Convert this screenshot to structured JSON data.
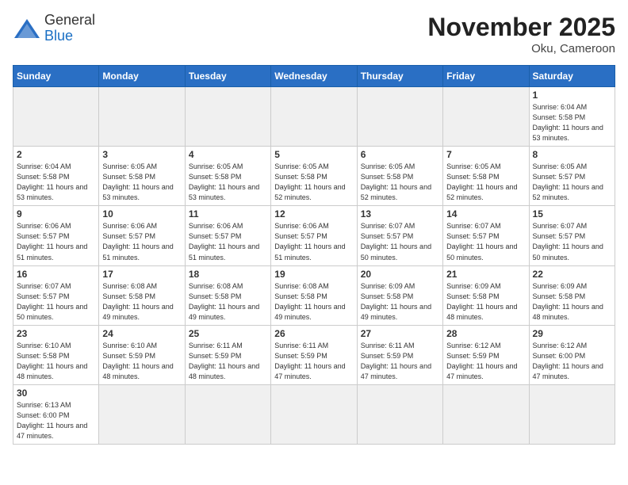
{
  "header": {
    "logo_general": "General",
    "logo_blue": "Blue",
    "month": "November 2025",
    "location": "Oku, Cameroon"
  },
  "days_of_week": [
    "Sunday",
    "Monday",
    "Tuesday",
    "Wednesday",
    "Thursday",
    "Friday",
    "Saturday"
  ],
  "weeks": [
    [
      {
        "day": "",
        "empty": true
      },
      {
        "day": "",
        "empty": true
      },
      {
        "day": "",
        "empty": true
      },
      {
        "day": "",
        "empty": true
      },
      {
        "day": "",
        "empty": true
      },
      {
        "day": "",
        "empty": true
      },
      {
        "day": "1",
        "sunrise": "Sunrise: 6:04 AM",
        "sunset": "Sunset: 5:58 PM",
        "daylight": "Daylight: 11 hours and 53 minutes."
      }
    ],
    [
      {
        "day": "2",
        "sunrise": "Sunrise: 6:04 AM",
        "sunset": "Sunset: 5:58 PM",
        "daylight": "Daylight: 11 hours and 53 minutes."
      },
      {
        "day": "3",
        "sunrise": "Sunrise: 6:05 AM",
        "sunset": "Sunset: 5:58 PM",
        "daylight": "Daylight: 11 hours and 53 minutes."
      },
      {
        "day": "4",
        "sunrise": "Sunrise: 6:05 AM",
        "sunset": "Sunset: 5:58 PM",
        "daylight": "Daylight: 11 hours and 53 minutes."
      },
      {
        "day": "5",
        "sunrise": "Sunrise: 6:05 AM",
        "sunset": "Sunset: 5:58 PM",
        "daylight": "Daylight: 11 hours and 52 minutes."
      },
      {
        "day": "6",
        "sunrise": "Sunrise: 6:05 AM",
        "sunset": "Sunset: 5:58 PM",
        "daylight": "Daylight: 11 hours and 52 minutes."
      },
      {
        "day": "7",
        "sunrise": "Sunrise: 6:05 AM",
        "sunset": "Sunset: 5:58 PM",
        "daylight": "Daylight: 11 hours and 52 minutes."
      },
      {
        "day": "8",
        "sunrise": "Sunrise: 6:05 AM",
        "sunset": "Sunset: 5:57 PM",
        "daylight": "Daylight: 11 hours and 52 minutes."
      }
    ],
    [
      {
        "day": "9",
        "sunrise": "Sunrise: 6:06 AM",
        "sunset": "Sunset: 5:57 PM",
        "daylight": "Daylight: 11 hours and 51 minutes."
      },
      {
        "day": "10",
        "sunrise": "Sunrise: 6:06 AM",
        "sunset": "Sunset: 5:57 PM",
        "daylight": "Daylight: 11 hours and 51 minutes."
      },
      {
        "day": "11",
        "sunrise": "Sunrise: 6:06 AM",
        "sunset": "Sunset: 5:57 PM",
        "daylight": "Daylight: 11 hours and 51 minutes."
      },
      {
        "day": "12",
        "sunrise": "Sunrise: 6:06 AM",
        "sunset": "Sunset: 5:57 PM",
        "daylight": "Daylight: 11 hours and 51 minutes."
      },
      {
        "day": "13",
        "sunrise": "Sunrise: 6:07 AM",
        "sunset": "Sunset: 5:57 PM",
        "daylight": "Daylight: 11 hours and 50 minutes."
      },
      {
        "day": "14",
        "sunrise": "Sunrise: 6:07 AM",
        "sunset": "Sunset: 5:57 PM",
        "daylight": "Daylight: 11 hours and 50 minutes."
      },
      {
        "day": "15",
        "sunrise": "Sunrise: 6:07 AM",
        "sunset": "Sunset: 5:57 PM",
        "daylight": "Daylight: 11 hours and 50 minutes."
      }
    ],
    [
      {
        "day": "16",
        "sunrise": "Sunrise: 6:07 AM",
        "sunset": "Sunset: 5:57 PM",
        "daylight": "Daylight: 11 hours and 50 minutes."
      },
      {
        "day": "17",
        "sunrise": "Sunrise: 6:08 AM",
        "sunset": "Sunset: 5:58 PM",
        "daylight": "Daylight: 11 hours and 49 minutes."
      },
      {
        "day": "18",
        "sunrise": "Sunrise: 6:08 AM",
        "sunset": "Sunset: 5:58 PM",
        "daylight": "Daylight: 11 hours and 49 minutes."
      },
      {
        "day": "19",
        "sunrise": "Sunrise: 6:08 AM",
        "sunset": "Sunset: 5:58 PM",
        "daylight": "Daylight: 11 hours and 49 minutes."
      },
      {
        "day": "20",
        "sunrise": "Sunrise: 6:09 AM",
        "sunset": "Sunset: 5:58 PM",
        "daylight": "Daylight: 11 hours and 49 minutes."
      },
      {
        "day": "21",
        "sunrise": "Sunrise: 6:09 AM",
        "sunset": "Sunset: 5:58 PM",
        "daylight": "Daylight: 11 hours and 48 minutes."
      },
      {
        "day": "22",
        "sunrise": "Sunrise: 6:09 AM",
        "sunset": "Sunset: 5:58 PM",
        "daylight": "Daylight: 11 hours and 48 minutes."
      }
    ],
    [
      {
        "day": "23",
        "sunrise": "Sunrise: 6:10 AM",
        "sunset": "Sunset: 5:58 PM",
        "daylight": "Daylight: 11 hours and 48 minutes."
      },
      {
        "day": "24",
        "sunrise": "Sunrise: 6:10 AM",
        "sunset": "Sunset: 5:59 PM",
        "daylight": "Daylight: 11 hours and 48 minutes."
      },
      {
        "day": "25",
        "sunrise": "Sunrise: 6:11 AM",
        "sunset": "Sunset: 5:59 PM",
        "daylight": "Daylight: 11 hours and 48 minutes."
      },
      {
        "day": "26",
        "sunrise": "Sunrise: 6:11 AM",
        "sunset": "Sunset: 5:59 PM",
        "daylight": "Daylight: 11 hours and 47 minutes."
      },
      {
        "day": "27",
        "sunrise": "Sunrise: 6:11 AM",
        "sunset": "Sunset: 5:59 PM",
        "daylight": "Daylight: 11 hours and 47 minutes."
      },
      {
        "day": "28",
        "sunrise": "Sunrise: 6:12 AM",
        "sunset": "Sunset: 5:59 PM",
        "daylight": "Daylight: 11 hours and 47 minutes."
      },
      {
        "day": "29",
        "sunrise": "Sunrise: 6:12 AM",
        "sunset": "Sunset: 6:00 PM",
        "daylight": "Daylight: 11 hours and 47 minutes."
      }
    ],
    [
      {
        "day": "30",
        "sunrise": "Sunrise: 6:13 AM",
        "sunset": "Sunset: 6:00 PM",
        "daylight": "Daylight: 11 hours and 47 minutes.",
        "has_data": true
      },
      {
        "day": "",
        "empty": true
      },
      {
        "day": "",
        "empty": true
      },
      {
        "day": "",
        "empty": true
      },
      {
        "day": "",
        "empty": true
      },
      {
        "day": "",
        "empty": true
      },
      {
        "day": "",
        "empty": true
      }
    ]
  ]
}
